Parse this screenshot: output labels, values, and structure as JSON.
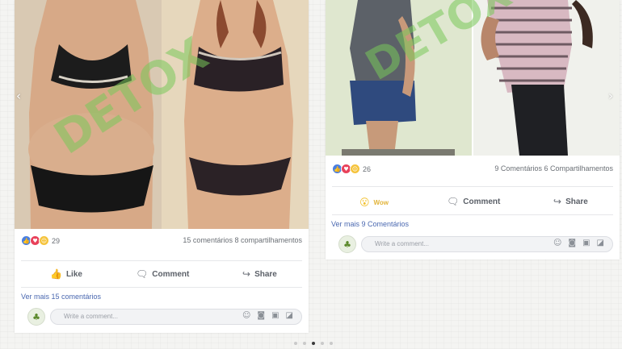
{
  "left_post": {
    "watermark": "DETOX",
    "reaction_count": "29",
    "stats": "15 comentários 8 compartilhamentos",
    "actions": {
      "like": "Like",
      "comment": "Comment",
      "share": "Share"
    },
    "more_comments": "Ver mais 15 comentários",
    "comment_placeholder": "Write a comment..."
  },
  "right_post": {
    "watermark": "DETOX",
    "reaction_count": "26",
    "stats": "9 Comentários 6 Compartilhamentos",
    "actions": {
      "wow": "Wow",
      "comment": "Comment",
      "share": "Share"
    },
    "more_comments": "Ver mais 9 Comentários",
    "comment_placeholder": "Write a comment..."
  },
  "carousel": {
    "total_slides": 5,
    "active_slide": 3
  },
  "colors": {
    "like_blue": "#4a7fe0",
    "love_red": "#e8415a",
    "haha_yellow": "#f5c33b",
    "wow_yellow": "#f2c12e",
    "link_blue": "#4a68b0",
    "watermark_green": "#78c85a"
  },
  "icons": [
    "like-reaction-icon",
    "love-reaction-icon",
    "haha-reaction-icon",
    "wow-reaction-icon",
    "thumbs-up-icon",
    "comment-icon",
    "share-icon",
    "emoji-icon",
    "camera-icon",
    "gif-icon",
    "sticker-icon",
    "chevron-left-icon",
    "chevron-right-icon"
  ]
}
